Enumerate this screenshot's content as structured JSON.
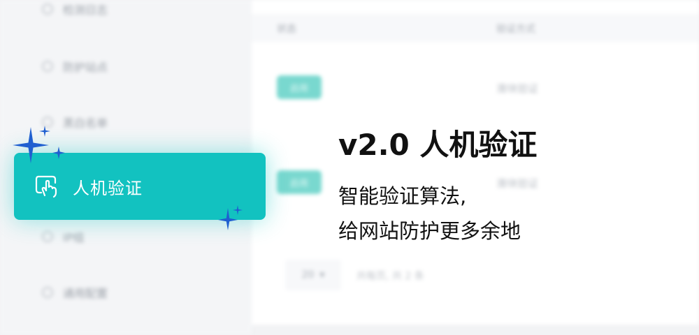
{
  "sidebar": {
    "items": [
      {
        "label": "检测日志"
      },
      {
        "label": "防护站点"
      },
      {
        "label": "黑白名单"
      },
      {
        "label": "人机验证"
      },
      {
        "label": "IP组"
      },
      {
        "label": "通用配置"
      }
    ]
  },
  "table": {
    "headers": [
      "状态",
      "验证方式"
    ],
    "rows": [
      {
        "status": "启用",
        "method": "滑块验证"
      },
      {
        "status": "启用",
        "method": "滑块验证"
      }
    ]
  },
  "pagination": {
    "page_size": "20",
    "summary": "共每页, 共 2 条"
  },
  "highlight": {
    "label": "人机验证",
    "icon": "hand-tap-icon",
    "accent_color": "#12c2c0"
  },
  "promo": {
    "title": "v2.0 人机验证",
    "lines": [
      "智能验证算法,",
      "给网站防护更多余地"
    ]
  }
}
